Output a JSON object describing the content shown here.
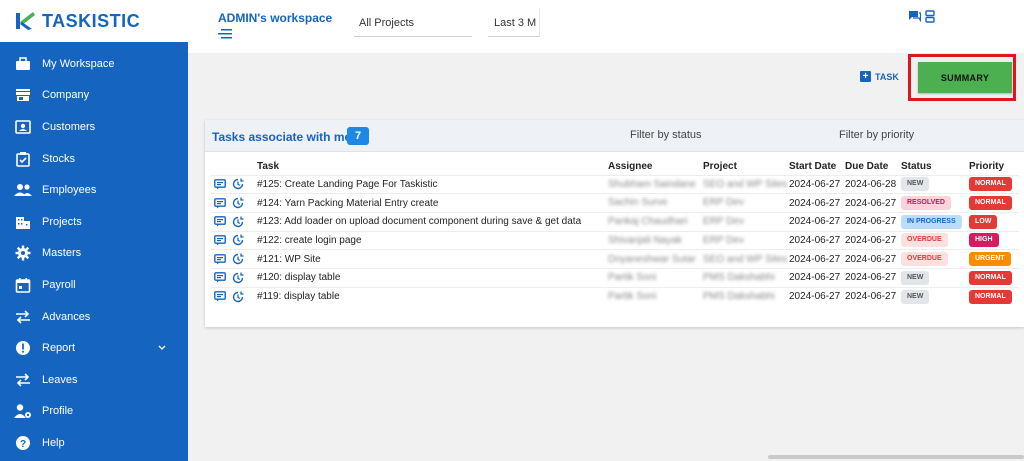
{
  "app": {
    "logo_text": "TASKISTIC"
  },
  "sidebar": {
    "items": [
      {
        "label": "My Workspace",
        "icon": "briefcase-icon"
      },
      {
        "label": "Company",
        "icon": "store-icon"
      },
      {
        "label": "Customers",
        "icon": "contact-card-icon"
      },
      {
        "label": "Stocks",
        "icon": "clipboard-icon"
      },
      {
        "label": "Employees",
        "icon": "people-icon"
      },
      {
        "label": "Projects",
        "icon": "building-icon"
      },
      {
        "label": "Masters",
        "icon": "gear-icon"
      },
      {
        "label": "Payroll",
        "icon": "calendar-icon"
      },
      {
        "label": "Advances",
        "icon": "swap-arrows-icon"
      },
      {
        "label": "Report",
        "icon": "alert-circle-icon"
      },
      {
        "label": "Leaves",
        "icon": "swap-arrows-icon"
      },
      {
        "label": "Profile",
        "icon": "user-settings-icon"
      },
      {
        "label": "Help",
        "icon": "help-circle-icon"
      }
    ]
  },
  "header": {
    "workspace_title": "ADMIN's workspace",
    "project_select": "All Projects",
    "range_select": "Last 3 M"
  },
  "actions": {
    "task_label": "TASK",
    "summary_label": "SUMMARY"
  },
  "tasks_card": {
    "title": "Tasks associate with me",
    "count": "7",
    "filter_status": "Filter by status",
    "filter_priority": "Filter by priority",
    "columns": [
      "Task",
      "Assignee",
      "Project",
      "Start Date",
      "Due Date",
      "Status",
      "Priority"
    ],
    "rows": [
      {
        "task": "#125: Create Landing Page For Taskistic",
        "assignee": "Shubham Saindane",
        "project": "SEO and WP Sites",
        "start": "2024-06-27",
        "due": "2024-06-28",
        "status": "NEW",
        "status_type": "new",
        "priority": "NORMAL",
        "priority_type": "normal"
      },
      {
        "task": "#124: Yarn Packing Material Entry create",
        "assignee": "Sachin Surve",
        "project": "ERP Dev",
        "start": "2024-06-27",
        "due": "2024-06-27",
        "status": "RESOLVED",
        "status_type": "resolved",
        "priority": "NORMAL",
        "priority_type": "normal"
      },
      {
        "task": "#123: Add loader on upload document component during save & get data",
        "assignee": "Pankaj Chaudhari",
        "project": "ERP Dev",
        "start": "2024-06-27",
        "due": "2024-06-27",
        "status": "IN PROGRESS",
        "status_type": "progress",
        "priority": "LOW",
        "priority_type": "low"
      },
      {
        "task": "#122: create login page",
        "assignee": "Shivanjali Nayak",
        "project": "ERP Dev",
        "start": "2024-06-27",
        "due": "2024-06-27",
        "status": "OVERDUE",
        "status_type": "overdue",
        "priority": "HIGH",
        "priority_type": "high"
      },
      {
        "task": "#121: WP Site",
        "assignee": "Dnyaneshwar Sutar",
        "project": "SEO and WP Sites",
        "start": "2024-06-27",
        "due": "2024-06-27",
        "status": "OVERDUE",
        "status_type": "overdue",
        "priority": "URGENT",
        "priority_type": "urgent"
      },
      {
        "task": "#120: display table",
        "assignee": "Partik Soni",
        "project": "PMS Dakshabhi",
        "start": "2024-06-27",
        "due": "2024-06-27",
        "status": "NEW",
        "status_type": "new",
        "priority": "NORMAL",
        "priority_type": "normal"
      },
      {
        "task": "#119: display table",
        "assignee": "Partik Soni",
        "project": "PMS Dakshabhi",
        "start": "2024-06-27",
        "due": "2024-06-27",
        "status": "NEW",
        "status_type": "new",
        "priority": "NORMAL",
        "priority_type": "normal"
      }
    ]
  },
  "colors": {
    "brand_blue": "#1565c0",
    "summary_green": "#4caf50",
    "highlight_red": "#e0161e"
  }
}
